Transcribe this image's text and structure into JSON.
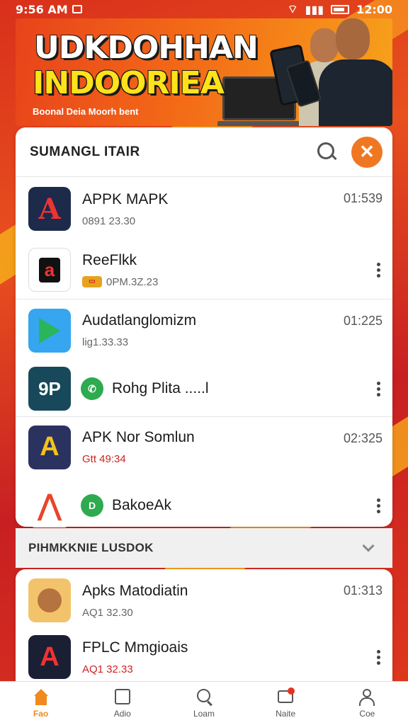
{
  "status_bar": {
    "time": "9:56 AM",
    "right_time": "12:00"
  },
  "banner": {
    "title_line1": "UDKDOHHAN",
    "title_line2": "INDOORIEA",
    "subtitle": "Boonal Deia Moorh bent"
  },
  "card1": {
    "title": "SUMANGL ITAIR",
    "rows": [
      {
        "name": "APPK MAPK",
        "sub": "0891 23.30",
        "time": "01:539"
      },
      {
        "name": "ReeFlkk",
        "sub": "0PM.3Z.23"
      },
      {
        "name": "Audatlanglomizm",
        "sub": "lig1.33.33",
        "time": "01:225"
      },
      {
        "name": "Rohg Plita .....l"
      },
      {
        "name": "APK Nor Somlun",
        "sub": "Gtt 49:34",
        "time": "02:325"
      },
      {
        "name": "BakoeAk"
      }
    ]
  },
  "section": {
    "title": "PIHMKKNIE LUSDOK"
  },
  "card2": {
    "rows": [
      {
        "name": "Apks Matodiatin",
        "sub": "AQ1 32.30",
        "time": "01:313"
      },
      {
        "name": "FPLC Mmgioais",
        "sub": "AQ1 32.33"
      }
    ]
  },
  "bottom_nav": [
    {
      "label": "Fao",
      "icon": "home-icon",
      "active": true
    },
    {
      "label": "Adio",
      "icon": "square-icon",
      "active": false
    },
    {
      "label": "Loam",
      "icon": "search-icon",
      "active": false
    },
    {
      "label": "Naite",
      "icon": "message-icon",
      "active": false
    },
    {
      "label": "Coe",
      "icon": "profile-icon",
      "active": false
    }
  ],
  "colors": {
    "accent": "#f07722",
    "banner": "#e8431b",
    "nav_active": "#f08a1d"
  }
}
